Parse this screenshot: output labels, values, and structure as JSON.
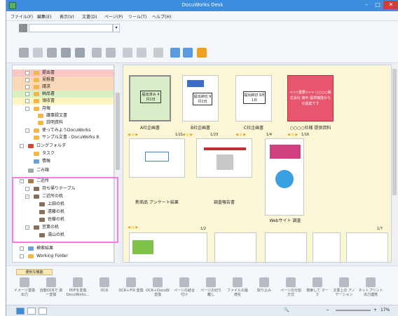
{
  "window": {
    "title": "DocuWorks Desk"
  },
  "menu": [
    "ファイル(F)",
    "編集(E)",
    "表示(V)",
    "文書(D)",
    "ページ(P)",
    "ツール(T)",
    "ヘルプ(H)"
  ],
  "tree": [
    {
      "label": "提出書",
      "hl": "pink"
    },
    {
      "label": "見積書",
      "hl": "peach"
    },
    {
      "label": "請求",
      "hl": "peach"
    },
    {
      "label": "納品書",
      "hl": "grn"
    },
    {
      "label": "領収書",
      "hl": "yel"
    },
    {
      "label": "月報",
      "hl": ""
    },
    {
      "label": "議事録文書",
      "hl": ""
    },
    {
      "label": "説明資料",
      "hl": ""
    },
    {
      "label": "使ってみようDocuWorks",
      "hl": ""
    },
    {
      "label": "サンプル文書 - DocuWorks 8",
      "hl": ""
    },
    {
      "label": "ロングフォルダ",
      "hl": ""
    },
    {
      "label": "タスク",
      "hl": ""
    },
    {
      "label": "情報",
      "hl": ""
    },
    {
      "label": "ごみ箱",
      "hl": ""
    },
    {
      "label": "ご近所",
      "hl": ""
    },
    {
      "label": "持ち帰りテーブル",
      "hl": ""
    },
    {
      "label": "ご近所の机",
      "hl": ""
    },
    {
      "label": "上田の机",
      "hl": ""
    },
    {
      "label": "遠藤の机",
      "hl": ""
    },
    {
      "label": "佐藤の机",
      "hl": ""
    },
    {
      "label": "営業の机",
      "hl": ""
    },
    {
      "label": "湯山の机",
      "hl": ""
    },
    {
      "label": "検索結果",
      "hl": ""
    },
    {
      "label": "Working Folder",
      "hl": ""
    }
  ],
  "docs": [
    {
      "label": "A社企画書",
      "thumb": "提出済み 4月1日",
      "pages": ""
    },
    {
      "label": "B社企画書",
      "thumb": "提出締切 9月1日",
      "pages": "1/23"
    },
    {
      "label": "C社企画書",
      "thumb": "提出締切 9月1日",
      "pages": "1/4"
    },
    {
      "label": "○○○○社様 提供資料",
      "thumb": "<<<重要>>> ○○○○株式会社 御中 提供機能からの提案です",
      "pages": "1/16"
    },
    {
      "label": "新商品 アンケート結果",
      "thumb": "",
      "pages": "1/21"
    },
    {
      "label": "調査報告書",
      "thumb": "",
      "pages": ""
    },
    {
      "label": "Webサイト 調査",
      "thumb": "",
      "pages": ""
    },
    {
      "label": "",
      "thumb": "",
      "pages": "1/2"
    },
    {
      "label": "",
      "thumb": "",
      "pages": "1/7"
    }
  ],
  "bottom_tab": "便利な機能",
  "bottom_items": [
    "イメージ変換 出力",
    "自動OCRで 高一変換",
    "PDFを変換 DocuWorks...",
    "OCR",
    "OCR＋FIX 変換",
    "OCR＋DocuW 変換",
    "ページの結合 付け",
    "ページの切り 離し",
    "ファイルの最 適化",
    "取り込み",
    "ページの分割 方式",
    "検索して マーク",
    "文書上の アノテーション",
    "ネットプリント 出力連携"
  ],
  "status": {
    "zoom": "17%"
  },
  "colors": {
    "titlebar": "#3c8dde",
    "pane": "#fbf7d6",
    "selection_box": "#f17fe0"
  }
}
